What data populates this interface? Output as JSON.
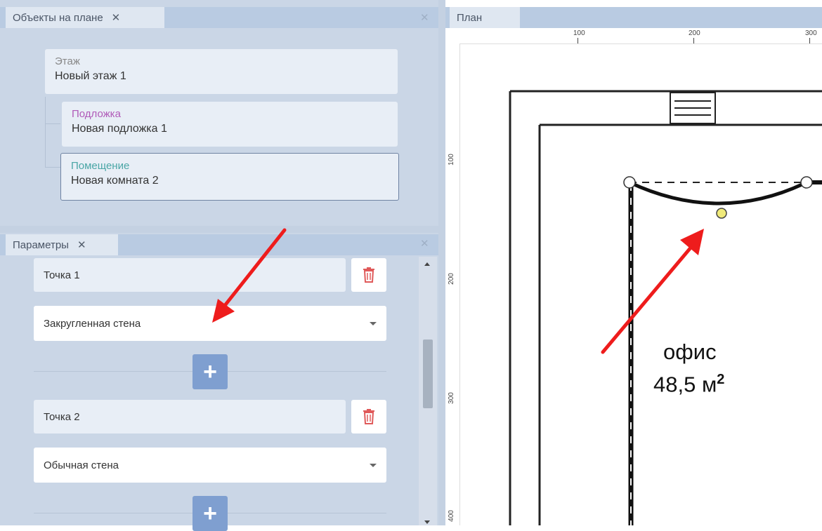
{
  "objects_panel": {
    "tab_label": "Объекты на плане",
    "tab_close": "✕",
    "panel_close": "✕",
    "tree": [
      {
        "type_label": "Этаж",
        "name": "Новый этаж 1",
        "type_color": "#888888"
      },
      {
        "type_label": "Подложка",
        "name": "Новая подложка 1",
        "type_color": "#b05ab8"
      },
      {
        "type_label": "Помещение",
        "name": "Новая комната 2",
        "type_color": "#4aa6a6"
      }
    ]
  },
  "params_panel": {
    "tab_label": "Параметры",
    "tab_close": "✕",
    "panel_close": "✕",
    "points": [
      {
        "label": "Точка 1",
        "wall_type": "Закругленная стена"
      },
      {
        "label": "Точка 2",
        "wall_type": "Обычная стена"
      }
    ],
    "add_button": "+"
  },
  "plan_panel": {
    "tab_label": "План",
    "ruler_top": [
      "100",
      "200",
      "300"
    ],
    "ruler_left": [
      "100",
      "200",
      "300",
      "400"
    ],
    "room_name": "офис",
    "room_area": "48,5 м",
    "room_area_sup": "2"
  },
  "colors": {
    "panel_bg": "#cad6e6",
    "tab_bar": "#b9cbe2",
    "accent_button": "#7f9fd0",
    "arrow": "#ee1c1c",
    "trash": "#e05a5a"
  }
}
